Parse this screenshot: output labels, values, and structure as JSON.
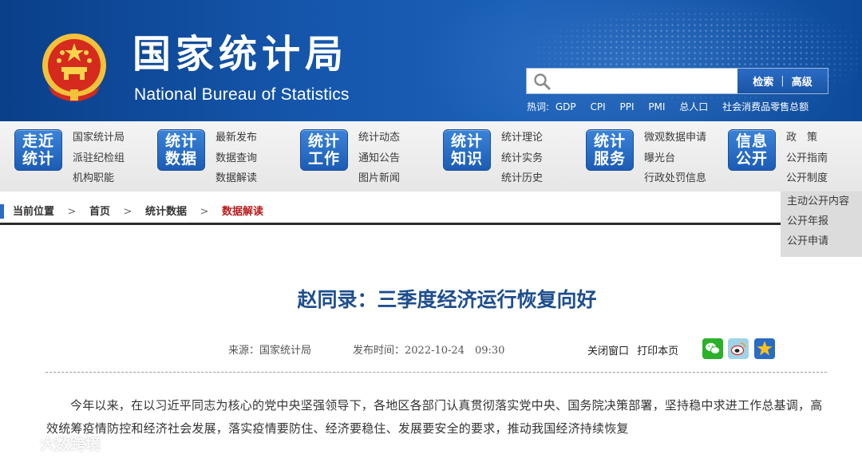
{
  "header": {
    "title": "国家统计局",
    "subtitle": "National Bureau of Statistics",
    "search": {
      "placeholder": "",
      "search_label": "检索",
      "advanced_label": "高级"
    },
    "hotwords_label": "热词:",
    "hotwords": [
      "GDP",
      "CPI",
      "PPI",
      "PMI",
      "总人口",
      "社会消费品零售总额"
    ]
  },
  "nav": [
    {
      "badge": [
        "走近",
        "统计"
      ],
      "links": [
        "国家统计局",
        "派驻纪检组",
        "机构职能"
      ]
    },
    {
      "badge": [
        "统计",
        "数据"
      ],
      "links": [
        "最新发布",
        "数据查询",
        "数据解读"
      ]
    },
    {
      "badge": [
        "统计",
        "工作"
      ],
      "links": [
        "统计动态",
        "通知公告",
        "图片新闻"
      ]
    },
    {
      "badge": [
        "统计",
        "知识"
      ],
      "links": [
        "统计理论",
        "统计实务",
        "统计历史"
      ]
    },
    {
      "badge": [
        "统计",
        "服务"
      ],
      "links": [
        "微观数据申请",
        "曝光台",
        "行政处罚信息"
      ]
    },
    {
      "badge": [
        "信息",
        "公开"
      ],
      "links": [
        "政　策",
        "公开指南",
        "公开制度"
      ]
    }
  ],
  "dropdown": [
    "主动公开内容",
    "公开年报",
    "公开申请"
  ],
  "breadcrumb": {
    "label": "当前位置",
    "items": [
      "首页",
      "统计数据",
      "数据解读"
    ]
  },
  "article": {
    "title": "赵同录：三季度经济运行恢复向好",
    "source": "来源：国家统计局",
    "published": "发布时间：2022-10-24　09:30",
    "close_label": "关闭窗口",
    "print_label": "打印本页",
    "paragraph": "今年以来，在以习近平同志为核心的党中央坚强领导下，各地区各部门认真贯彻落实党中央、国务院决策部署，坚持稳中求进工作总基调，高效统筹疫情防控和经济社会发展，落实疫情要防住、经济要稳住、发展要安全的要求，推动我国经济持续恢复"
  },
  "watermark": "大数跨境",
  "colors": {
    "header_blue": "#1556ab",
    "title_blue": "#1f4e8e",
    "crumb_red": "#b81c1c"
  }
}
